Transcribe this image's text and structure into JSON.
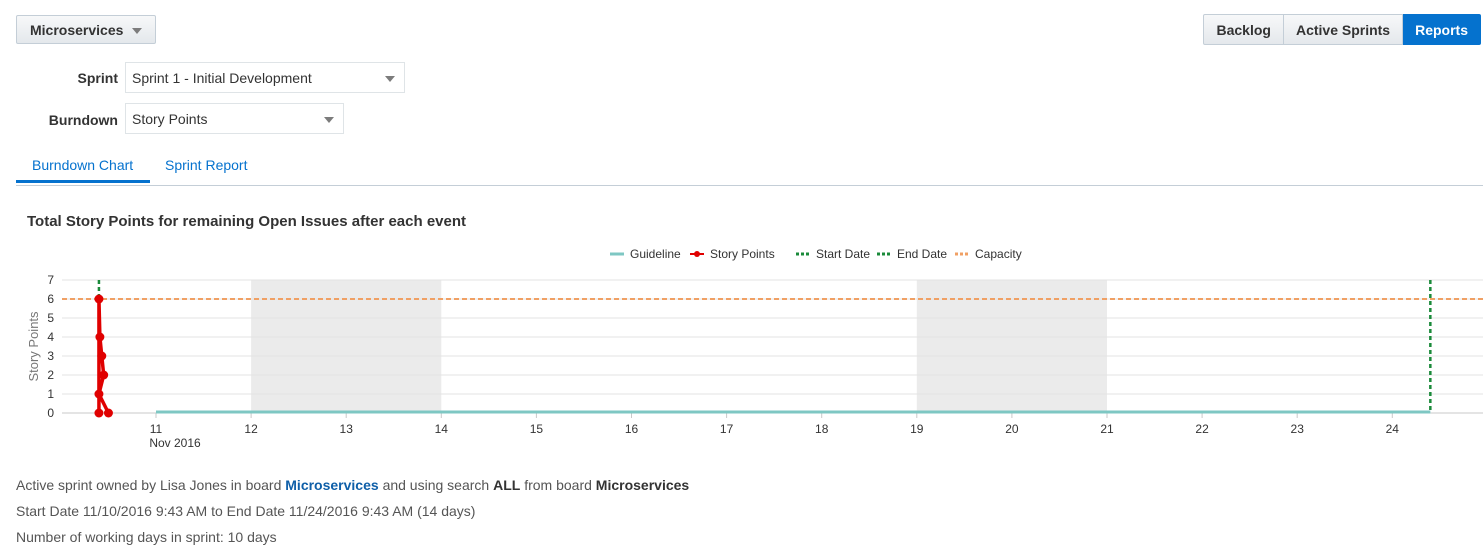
{
  "header": {
    "board_label": "Microservices",
    "nav": [
      "Backlog",
      "Active Sprints",
      "Reports"
    ],
    "active_nav": "Reports"
  },
  "form": {
    "sprint_label": "Sprint",
    "sprint_value": "Sprint 1 - Initial Development",
    "burndown_label": "Burndown",
    "burndown_value": "Story Points"
  },
  "tabs": {
    "burndown": "Burndown Chart",
    "sprint_report": "Sprint Report"
  },
  "chart_data": {
    "type": "line",
    "title": "Total Story Points for remaining Open Issues after each event",
    "ylabel": "Story Points",
    "ylim": [
      0,
      7
    ],
    "y_ticks": [
      "0",
      "1",
      "2",
      "3",
      "4",
      "5",
      "6",
      "7"
    ],
    "x_ticks": [
      {
        "label": "11",
        "sub": "Nov 2016",
        "day": 11
      },
      {
        "label": "12",
        "day": 12
      },
      {
        "label": "13",
        "day": 13
      },
      {
        "label": "14",
        "day": 14
      },
      {
        "label": "15",
        "day": 15
      },
      {
        "label": "16",
        "day": 16
      },
      {
        "label": "17",
        "day": 17
      },
      {
        "label": "18",
        "day": 18
      },
      {
        "label": "19",
        "day": 19
      },
      {
        "label": "20",
        "day": 20
      },
      {
        "label": "21",
        "day": 21
      },
      {
        "label": "22",
        "day": 22
      },
      {
        "label": "23",
        "day": 23
      },
      {
        "label": "24",
        "day": 24
      }
    ],
    "legend": [
      {
        "name": "Guideline",
        "color": "#7ec7c3",
        "style": "solid"
      },
      {
        "name": "Story Points",
        "color": "#e00000",
        "style": "marker"
      },
      {
        "name": "Start Date",
        "color": "#1a8a3a",
        "style": "dashed"
      },
      {
        "name": "End Date",
        "color": "#1a8a3a",
        "style": "dashed"
      },
      {
        "name": "Capacity",
        "color": "#f0a064",
        "style": "dashed"
      }
    ],
    "weekends": [
      [
        12,
        14
      ],
      [
        19,
        21
      ]
    ],
    "start_date_day": 10.4,
    "end_date_day": 24.4,
    "capacity": 6,
    "guideline": [
      {
        "x": 11,
        "y": 0
      },
      {
        "x": 24.4,
        "y": 0
      }
    ],
    "story_points": [
      {
        "x": 10.4,
        "y": 0
      },
      {
        "x": 10.4,
        "y": 6
      },
      {
        "x": 10.41,
        "y": 4
      },
      {
        "x": 10.43,
        "y": 3
      },
      {
        "x": 10.45,
        "y": 2
      },
      {
        "x": 10.4,
        "y": 1
      },
      {
        "x": 10.5,
        "y": 0
      }
    ],
    "grid": true
  },
  "info": {
    "line1_prefix": "Active sprint owned by Lisa Jones in board",
    "line1_board": "Microservices",
    "line1_mid": "and using search",
    "line1_search": "ALL",
    "line1_mid2": "from board",
    "line1_board2": "Microservices",
    "line2": "Start Date 11/10/2016 9:43 AM to End Date 11/24/2016 9:43 AM (14 days)",
    "line3": "Number of working days in sprint: 10 days"
  },
  "colors": {
    "accent": "#0572ce",
    "weekend_shade": "#ebebeb",
    "story_points": "#e00000",
    "guideline": "#7ec7c3",
    "start_end": "#1a8a3a",
    "capacity": "#f0a064"
  }
}
